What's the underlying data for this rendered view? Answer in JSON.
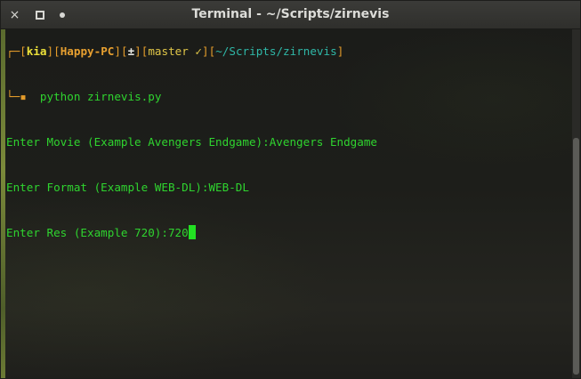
{
  "window": {
    "title": "Terminal - ~/Scripts/zirnevis",
    "buttons": {
      "close": "×",
      "maximize": "",
      "minimize": ""
    }
  },
  "terminal": {
    "prompt": {
      "tree_top": "┌─",
      "lb1": "[",
      "user": "kia",
      "rb1": "]",
      "lb2": "[",
      "host": "Happy-PC",
      "rb2": "]",
      "lb3": "[",
      "git_flag": "±",
      "rb3": "]",
      "lb4": "[",
      "branch": "master ✓",
      "rb4": "]",
      "lb5": "[",
      "directory": "~/Scripts/zirnevis",
      "rb5": "]",
      "tree_bottom": "└─▪",
      "command": "python zirnevis.py"
    },
    "output": [
      "Enter Movie (Example Avengers Endgame):Avengers Endgame",
      "Enter Format (Example WEB-DL):WEB-DL"
    ],
    "current_line": "Enter Res (Example 720):720"
  },
  "colors": {
    "text_green": "#2fd42f",
    "bracket_orange": "#e39b2a",
    "user_yellow": "#ede23a",
    "directory_teal": "#2fb8a8",
    "cursor": "#22e022"
  }
}
